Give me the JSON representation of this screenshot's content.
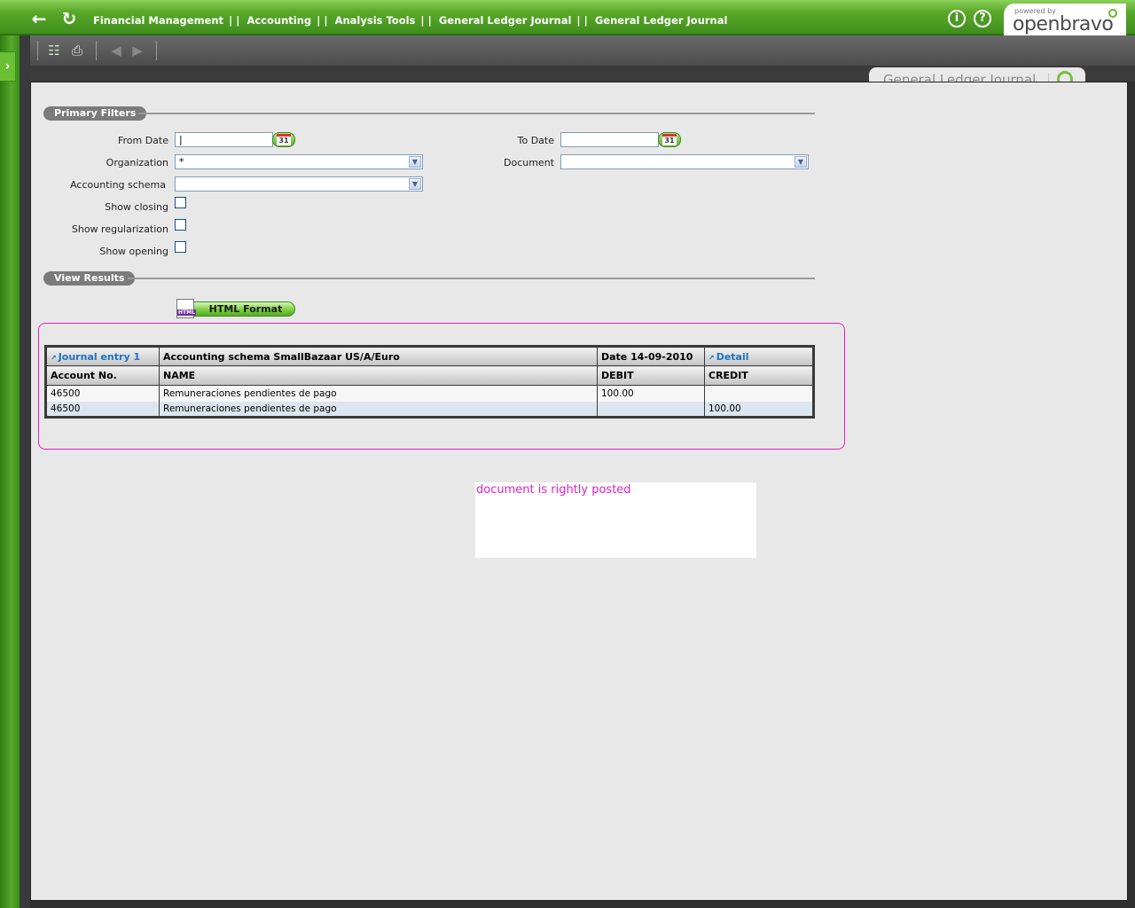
{
  "breadcrumb": {
    "items": [
      "Financial Management",
      "Accounting",
      "Analysis Tools",
      "General Ledger Journal",
      "General Ledger Journal"
    ],
    "separators": [
      "| |",
      "| |",
      "| |",
      "| |"
    ]
  },
  "header": {
    "powered_by": "powered by",
    "logo": "openbravo",
    "info_label": "i",
    "help_label": "?"
  },
  "tab": {
    "title": "General Ledger Journal"
  },
  "primary_filters": {
    "title": "Primary Filters",
    "from_date_label": "From Date",
    "from_date_value": "|",
    "to_date_label": "To Date",
    "to_date_value": "",
    "calendar_day": "31",
    "organization_label": "Organization",
    "organization_value": "*",
    "document_label": "Document",
    "document_value": "",
    "accounting_schema_label": "Accounting schema",
    "accounting_schema_value": "",
    "show_closing_label": "Show closing",
    "show_regularization_label": "Show regularization",
    "show_opening_label": "Show opening"
  },
  "view_results": {
    "title": "View Results",
    "html_button": "HTML Format",
    "html_icon_text": "HTML"
  },
  "ledger": {
    "journal_entry": "Journal entry 1",
    "schema": "Accounting schema SmallBazaar US/A/Euro",
    "date": "Date 14-09-2010",
    "detail": "Detail",
    "columns": [
      "Account No.",
      "NAME",
      "DEBIT",
      "CREDIT"
    ],
    "rows": [
      {
        "account": "46500",
        "name": "Remuneraciones pendientes de pago",
        "debit": "100.00",
        "credit": ""
      },
      {
        "account": "46500",
        "name": "Remuneraciones pendientes de pago",
        "debit": "",
        "credit": "100.00"
      }
    ]
  },
  "note": "document is rightly posted",
  "colors": {
    "accent_green": "#5aa82a",
    "annotation_magenta": "#e020c8",
    "link_blue": "#1e73c4"
  },
  "icons": [
    "back-arrow-icon",
    "refresh-icon",
    "info-icon",
    "help-icon",
    "excel-icon",
    "print-icon",
    "previous-icon",
    "next-icon",
    "calendar-icon",
    "dropdown-arrow-icon",
    "html-file-icon",
    "sidebar-toggle-icon"
  ]
}
